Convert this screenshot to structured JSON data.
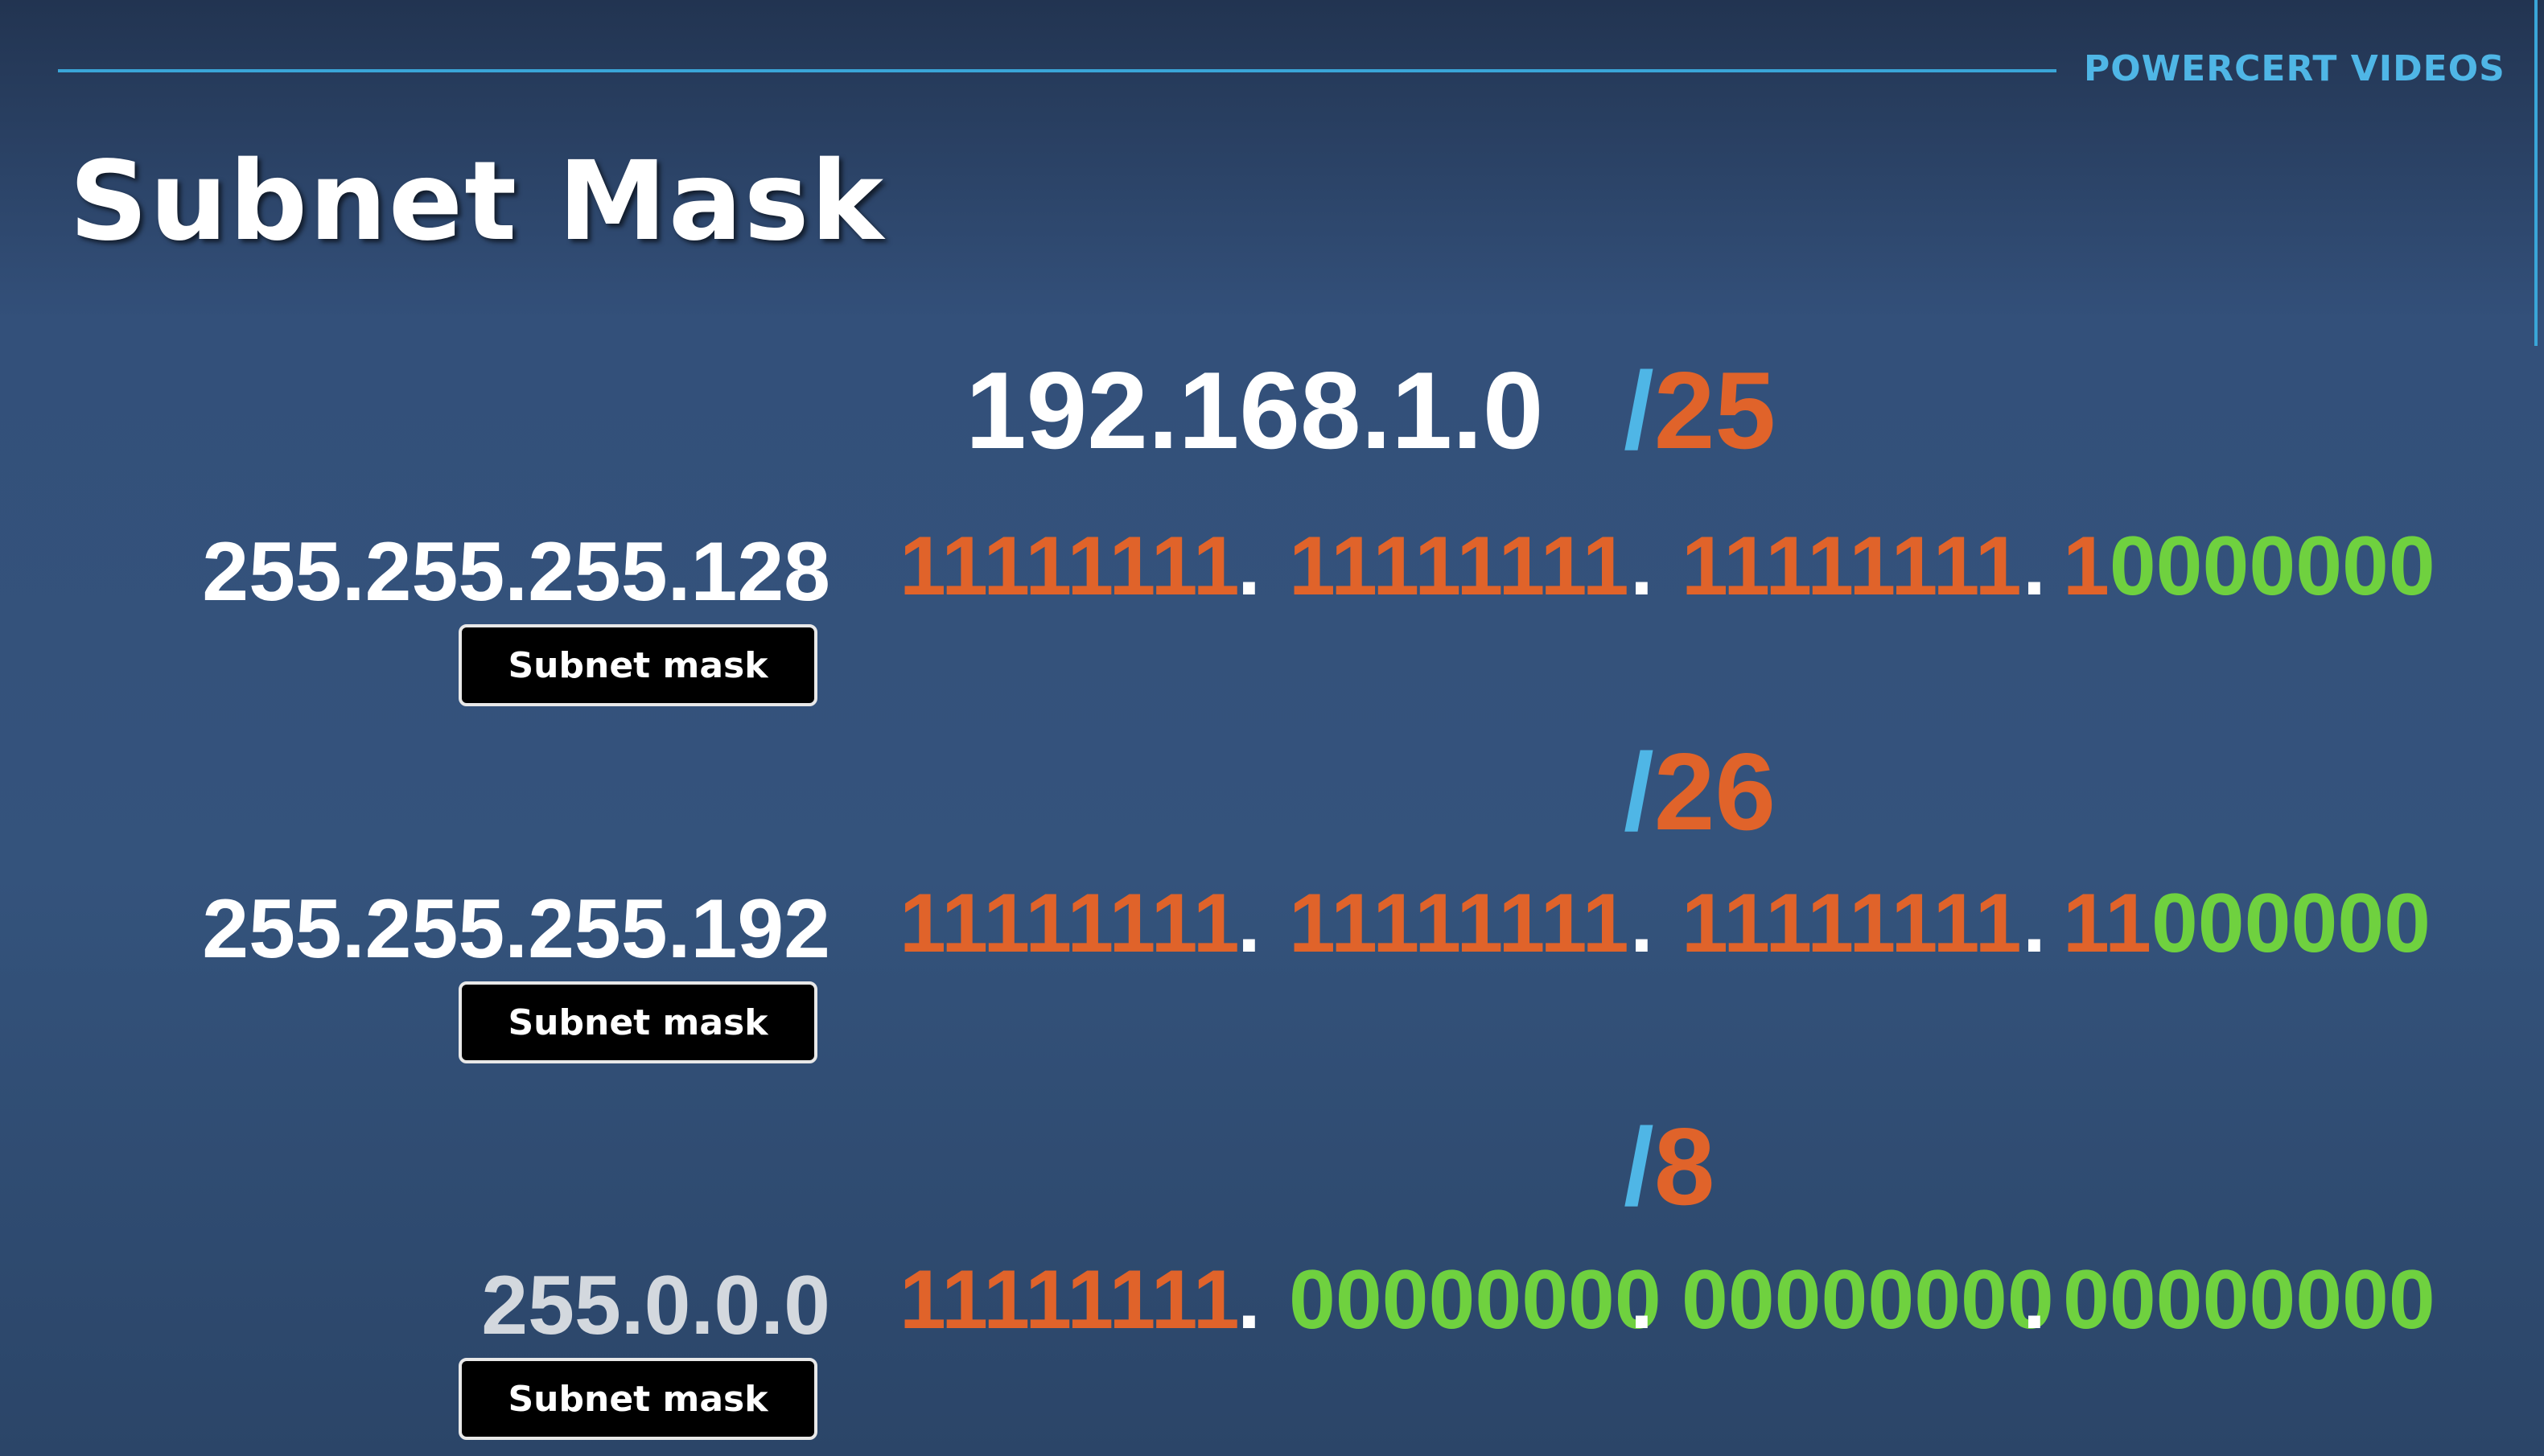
{
  "brand": "POWERCERT VIDEOS",
  "title": "Subnet Mask",
  "network": "192.168.1.0",
  "rows": [
    {
      "prefix_slash": "/",
      "prefix_value": "25",
      "dotted_mask": "255.255.255.128",
      "badge_label": "Subnet mask",
      "octets": [
        "11111111",
        "11111111",
        "11111111",
        "10000000"
      ],
      "network_bits": [
        8,
        8,
        8,
        1
      ]
    },
    {
      "prefix_slash": "/",
      "prefix_value": "26",
      "dotted_mask": "255.255.255.192",
      "badge_label": "Subnet mask",
      "octets": [
        "11111111",
        "11111111",
        "11111111",
        "11000000"
      ],
      "network_bits": [
        8,
        8,
        8,
        2
      ]
    },
    {
      "prefix_slash": "/",
      "prefix_value": "8",
      "dotted_mask": "255.0.0.0",
      "badge_label": "Subnet mask",
      "octets": [
        "11111111",
        "00000000",
        "00000000",
        "00000000"
      ],
      "network_bits": [
        8,
        0,
        0,
        0
      ]
    }
  ],
  "separator": ".",
  "colors": {
    "background": "#33507a",
    "accent_line": "#3aa6d8",
    "brand_text": "#4fb6e6",
    "slash": "#4fb6e6",
    "prefix_number": "#e0632a",
    "network_bit": "#e0632a",
    "host_bit": "#6fd13f",
    "badge_bg": "#000000"
  }
}
